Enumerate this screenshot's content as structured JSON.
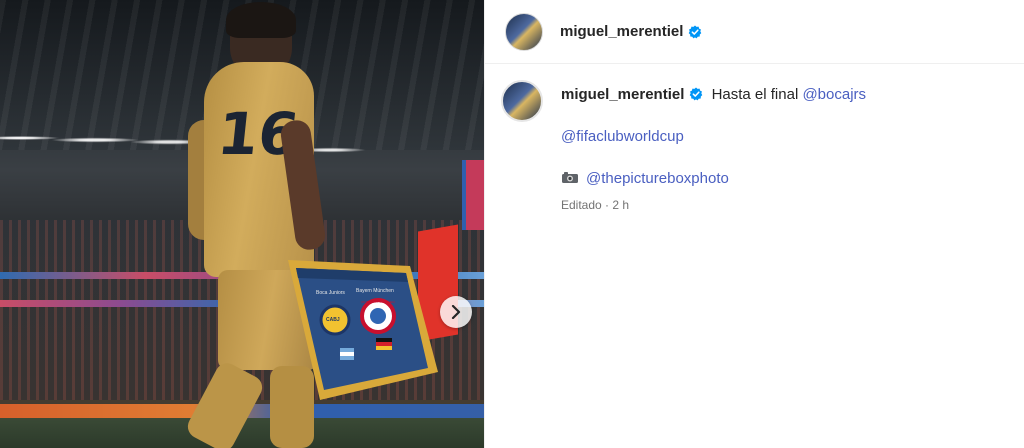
{
  "post": {
    "author": {
      "username": "miguel_merentiel",
      "verified": true,
      "avatar_icon": "profile-avatar"
    },
    "media": {
      "next_icon": "chevron-right-icon",
      "jersey_number": "16",
      "pennant": {
        "team_left": "Boca Juniors",
        "team_right": "Bayern München",
        "crest_left": "CABJ",
        "crest_right": "FC BAYERN MÜNCHEN"
      }
    },
    "caption": {
      "text": "Hasta el final",
      "mention_1": "@bocajrs",
      "mention_2": "@fifaclubworldcup",
      "camera_emoji": "camera-icon",
      "mention_3": "@thepictureboxphoto",
      "edited": "Editado",
      "separator": "·",
      "time": "2 h"
    }
  },
  "colors": {
    "link": "#4a5fc1",
    "verified": "#0095f6",
    "text": "#262626",
    "muted": "#737373"
  }
}
